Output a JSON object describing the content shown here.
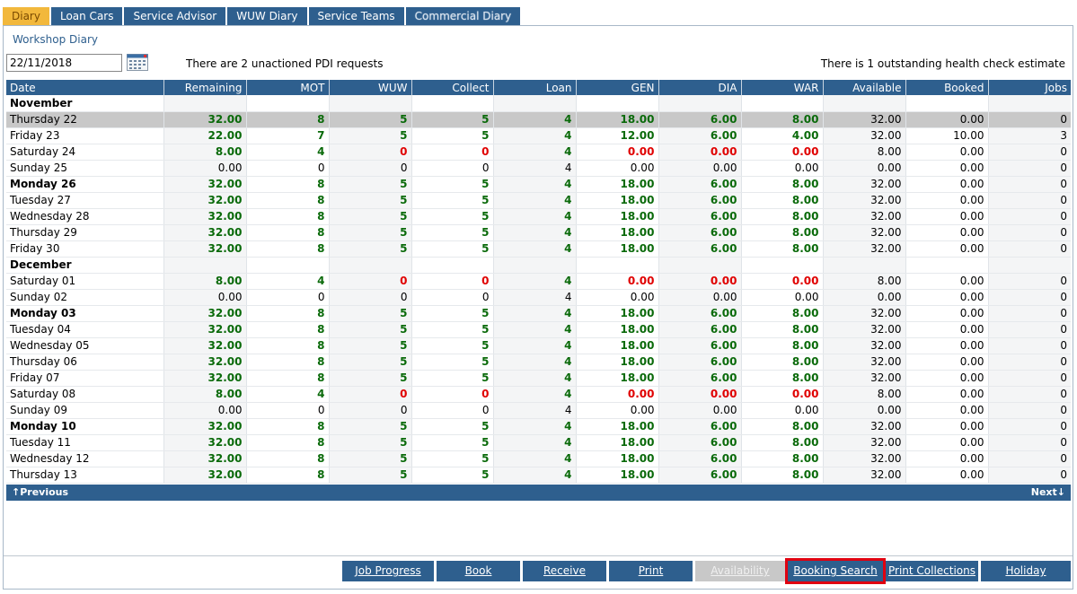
{
  "tabs": [
    {
      "label": "Diary"
    },
    {
      "label": "Loan Cars"
    },
    {
      "label": "Service Advisor"
    },
    {
      "label": "WUW Diary"
    },
    {
      "label": "Service Teams"
    },
    {
      "label": "Commercial Diary"
    }
  ],
  "page_title": "Workshop Diary",
  "date_value": "22/11/2018",
  "pdi_message": "There are 2 unactioned PDI requests",
  "health_message": "There is 1 outstanding health check estimate",
  "columns": [
    "Date",
    "Remaining",
    "MOT",
    "WUW",
    "Collect",
    "Loan",
    "GEN",
    "DIA",
    "WAR",
    "Available",
    "Booked",
    "Jobs"
  ],
  "rows": [
    {
      "type": "month",
      "date": "November"
    },
    {
      "type": "day",
      "style": "highlight",
      "date": "Thursday 22",
      "remaining": "32.00",
      "mot": "8",
      "wuw": "5",
      "collect": "5",
      "loan": "4",
      "gen": "18.00",
      "dia": "6.00",
      "war": "8.00",
      "available": "32.00",
      "booked": "0.00",
      "jobs": "0"
    },
    {
      "type": "day",
      "style": "",
      "date": "Friday 23",
      "remaining": "22.00",
      "mot": "7",
      "wuw": "5",
      "collect": "5",
      "loan": "4",
      "gen": "12.00",
      "dia": "6.00",
      "war": "4.00",
      "available": "32.00",
      "booked": "10.00",
      "jobs": "3"
    },
    {
      "type": "day",
      "style": "sat",
      "date": "Saturday 24",
      "remaining": "8.00",
      "mot": "4",
      "wuw": "0",
      "collect": "0",
      "loan": "4",
      "gen": "0.00",
      "dia": "0.00",
      "war": "0.00",
      "available": "8.00",
      "booked": "0.00",
      "jobs": "0"
    },
    {
      "type": "day",
      "style": "sun",
      "date": "Sunday 25",
      "remaining": "0.00",
      "mot": "0",
      "wuw": "0",
      "collect": "0",
      "loan": "4",
      "gen": "0.00",
      "dia": "0.00",
      "war": "0.00",
      "available": "0.00",
      "booked": "0.00",
      "jobs": "0"
    },
    {
      "type": "day",
      "style": "bold",
      "date": "Monday 26",
      "remaining": "32.00",
      "mot": "8",
      "wuw": "5",
      "collect": "5",
      "loan": "4",
      "gen": "18.00",
      "dia": "6.00",
      "war": "8.00",
      "available": "32.00",
      "booked": "0.00",
      "jobs": "0"
    },
    {
      "type": "day",
      "style": "",
      "date": "Tuesday 27",
      "remaining": "32.00",
      "mot": "8",
      "wuw": "5",
      "collect": "5",
      "loan": "4",
      "gen": "18.00",
      "dia": "6.00",
      "war": "8.00",
      "available": "32.00",
      "booked": "0.00",
      "jobs": "0"
    },
    {
      "type": "day",
      "style": "",
      "date": "Wednesday 28",
      "remaining": "32.00",
      "mot": "8",
      "wuw": "5",
      "collect": "5",
      "loan": "4",
      "gen": "18.00",
      "dia": "6.00",
      "war": "8.00",
      "available": "32.00",
      "booked": "0.00",
      "jobs": "0"
    },
    {
      "type": "day",
      "style": "",
      "date": "Thursday 29",
      "remaining": "32.00",
      "mot": "8",
      "wuw": "5",
      "collect": "5",
      "loan": "4",
      "gen": "18.00",
      "dia": "6.00",
      "war": "8.00",
      "available": "32.00",
      "booked": "0.00",
      "jobs": "0"
    },
    {
      "type": "day",
      "style": "",
      "date": "Friday 30",
      "remaining": "32.00",
      "mot": "8",
      "wuw": "5",
      "collect": "5",
      "loan": "4",
      "gen": "18.00",
      "dia": "6.00",
      "war": "8.00",
      "available": "32.00",
      "booked": "0.00",
      "jobs": "0"
    },
    {
      "type": "month",
      "date": "December"
    },
    {
      "type": "day",
      "style": "sat",
      "date": "Saturday 01",
      "remaining": "8.00",
      "mot": "4",
      "wuw": "0",
      "collect": "0",
      "loan": "4",
      "gen": "0.00",
      "dia": "0.00",
      "war": "0.00",
      "available": "8.00",
      "booked": "0.00",
      "jobs": "0"
    },
    {
      "type": "day",
      "style": "sun",
      "date": "Sunday 02",
      "remaining": "0.00",
      "mot": "0",
      "wuw": "0",
      "collect": "0",
      "loan": "4",
      "gen": "0.00",
      "dia": "0.00",
      "war": "0.00",
      "available": "0.00",
      "booked": "0.00",
      "jobs": "0"
    },
    {
      "type": "day",
      "style": "bold",
      "date": "Monday 03",
      "remaining": "32.00",
      "mot": "8",
      "wuw": "5",
      "collect": "5",
      "loan": "4",
      "gen": "18.00",
      "dia": "6.00",
      "war": "8.00",
      "available": "32.00",
      "booked": "0.00",
      "jobs": "0"
    },
    {
      "type": "day",
      "style": "",
      "date": "Tuesday 04",
      "remaining": "32.00",
      "mot": "8",
      "wuw": "5",
      "collect": "5",
      "loan": "4",
      "gen": "18.00",
      "dia": "6.00",
      "war": "8.00",
      "available": "32.00",
      "booked": "0.00",
      "jobs": "0"
    },
    {
      "type": "day",
      "style": "",
      "date": "Wednesday 05",
      "remaining": "32.00",
      "mot": "8",
      "wuw": "5",
      "collect": "5",
      "loan": "4",
      "gen": "18.00",
      "dia": "6.00",
      "war": "8.00",
      "available": "32.00",
      "booked": "0.00",
      "jobs": "0"
    },
    {
      "type": "day",
      "style": "",
      "date": "Thursday 06",
      "remaining": "32.00",
      "mot": "8",
      "wuw": "5",
      "collect": "5",
      "loan": "4",
      "gen": "18.00",
      "dia": "6.00",
      "war": "8.00",
      "available": "32.00",
      "booked": "0.00",
      "jobs": "0"
    },
    {
      "type": "day",
      "style": "",
      "date": "Friday 07",
      "remaining": "32.00",
      "mot": "8",
      "wuw": "5",
      "collect": "5",
      "loan": "4",
      "gen": "18.00",
      "dia": "6.00",
      "war": "8.00",
      "available": "32.00",
      "booked": "0.00",
      "jobs": "0"
    },
    {
      "type": "day",
      "style": "sat",
      "date": "Saturday 08",
      "remaining": "8.00",
      "mot": "4",
      "wuw": "0",
      "collect": "0",
      "loan": "4",
      "gen": "0.00",
      "dia": "0.00",
      "war": "0.00",
      "available": "8.00",
      "booked": "0.00",
      "jobs": "0"
    },
    {
      "type": "day",
      "style": "sun",
      "date": "Sunday 09",
      "remaining": "0.00",
      "mot": "0",
      "wuw": "0",
      "collect": "0",
      "loan": "4",
      "gen": "0.00",
      "dia": "0.00",
      "war": "0.00",
      "available": "0.00",
      "booked": "0.00",
      "jobs": "0"
    },
    {
      "type": "day",
      "style": "bold",
      "date": "Monday 10",
      "remaining": "32.00",
      "mot": "8",
      "wuw": "5",
      "collect": "5",
      "loan": "4",
      "gen": "18.00",
      "dia": "6.00",
      "war": "8.00",
      "available": "32.00",
      "booked": "0.00",
      "jobs": "0"
    },
    {
      "type": "day",
      "style": "",
      "date": "Tuesday 11",
      "remaining": "32.00",
      "mot": "8",
      "wuw": "5",
      "collect": "5",
      "loan": "4",
      "gen": "18.00",
      "dia": "6.00",
      "war": "8.00",
      "available": "32.00",
      "booked": "0.00",
      "jobs": "0"
    },
    {
      "type": "day",
      "style": "",
      "date": "Wednesday 12",
      "remaining": "32.00",
      "mot": "8",
      "wuw": "5",
      "collect": "5",
      "loan": "4",
      "gen": "18.00",
      "dia": "6.00",
      "war": "8.00",
      "available": "32.00",
      "booked": "0.00",
      "jobs": "0"
    },
    {
      "type": "day",
      "style": "",
      "date": "Thursday 13",
      "remaining": "32.00",
      "mot": "8",
      "wuw": "5",
      "collect": "5",
      "loan": "4",
      "gen": "18.00",
      "dia": "6.00",
      "war": "8.00",
      "available": "32.00",
      "booked": "0.00",
      "jobs": "0"
    }
  ],
  "nav": {
    "previous": "↑Previous",
    "next": "Next↓"
  },
  "buttons": [
    {
      "label": "Job Progress"
    },
    {
      "label": "Book"
    },
    {
      "label": "Receive"
    },
    {
      "label": "Print"
    },
    {
      "label": "Availability"
    },
    {
      "label": "Booking Search"
    },
    {
      "label": "Print Collections"
    },
    {
      "label": "Holiday"
    }
  ],
  "colors": {
    "accent": "#2e5f8e",
    "active_tab": "#f2b83c",
    "positive": "#0a6a0a",
    "zero": "#e00000",
    "focus_outline": "#e00010"
  }
}
